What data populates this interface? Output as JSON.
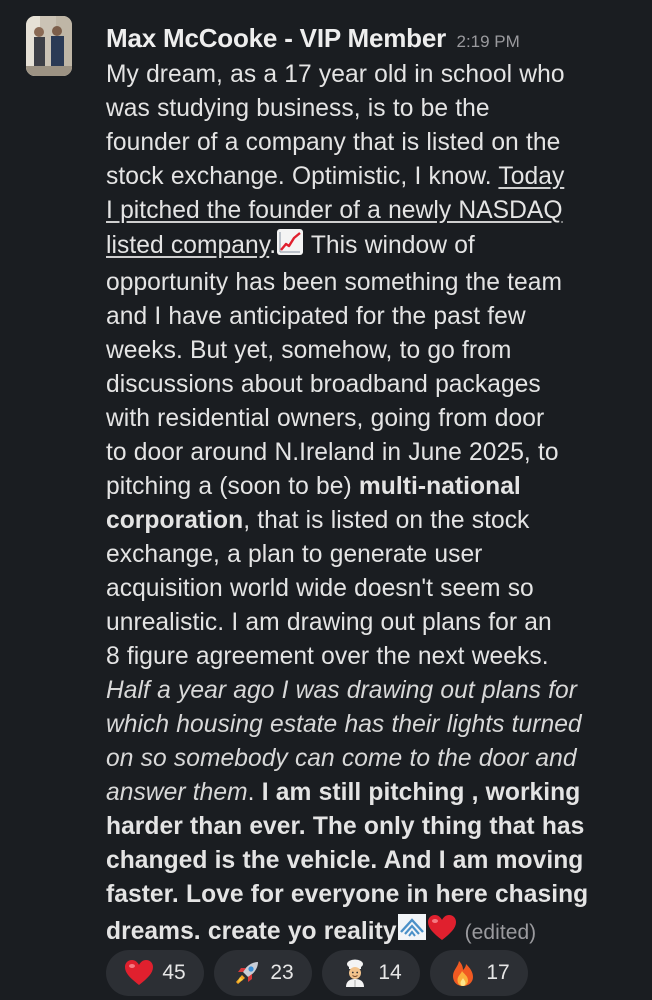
{
  "message": {
    "author": "Max McCooke - VIP Member",
    "timestamp": "2:19 PM",
    "edited_label": "(edited)",
    "lines": {
      "l1": "My dream, as a 17 year old in school who",
      "l2": "was studying business, is to be the",
      "l3": "founder of a company that is listed on the",
      "l4a": "stock exchange. Optimistic, I know. ",
      "l4b": "Today",
      "l5": "I pitched the founder of a newly NASDAQ",
      "l6a": "listed company",
      "l6b": ".",
      "l6c": " This window of",
      "l7": "opportunity has been something the team",
      "l8": "and I have anticipated for the past few",
      "l9": "weeks. But yet, somehow, to go from",
      "l10": "discussions about broadband packages",
      "l11": "with residential owners, going from door",
      "l12": "to door around N.Ireland in June 2025, to",
      "l13a": "pitching a (soon to be) ",
      "l13b": "multi-national",
      "l14a": "corporation",
      "l14b": ", that is listed on the stock",
      "l15": "exchange, a plan to generate user",
      "l16": "acquisition world wide doesn't seem so",
      "l17": "unrealistic. I am drawing out plans for an",
      "l18": "8 figure agreement over the next weeks.",
      "l19": "Half a year ago I was drawing out plans for",
      "l20": "which housing estate has their lights turned",
      "l21": "on so somebody can come to the door and",
      "l22a": "answer them",
      "l22b": ". ",
      "l22c": "I am still pitching , working",
      "l23": "harder than ever. The only thing that has",
      "l24": "changed is the vehicle. And I am moving",
      "l25": "faster. Love for everyone in here chasing",
      "l26": "dreams. create yo reality"
    }
  },
  "reactions": [
    {
      "emoji": "red-heart",
      "count": "45"
    },
    {
      "emoji": "rocket",
      "count": "23"
    },
    {
      "emoji": "cook",
      "count": "14"
    },
    {
      "emoji": "fire",
      "count": "17"
    }
  ],
  "colors": {
    "background": "#1a1d21",
    "text": "#e4e4e4",
    "muted": "#9a9a9e",
    "reaction_pill": "#2c2f34",
    "heart": "#e0202e"
  }
}
